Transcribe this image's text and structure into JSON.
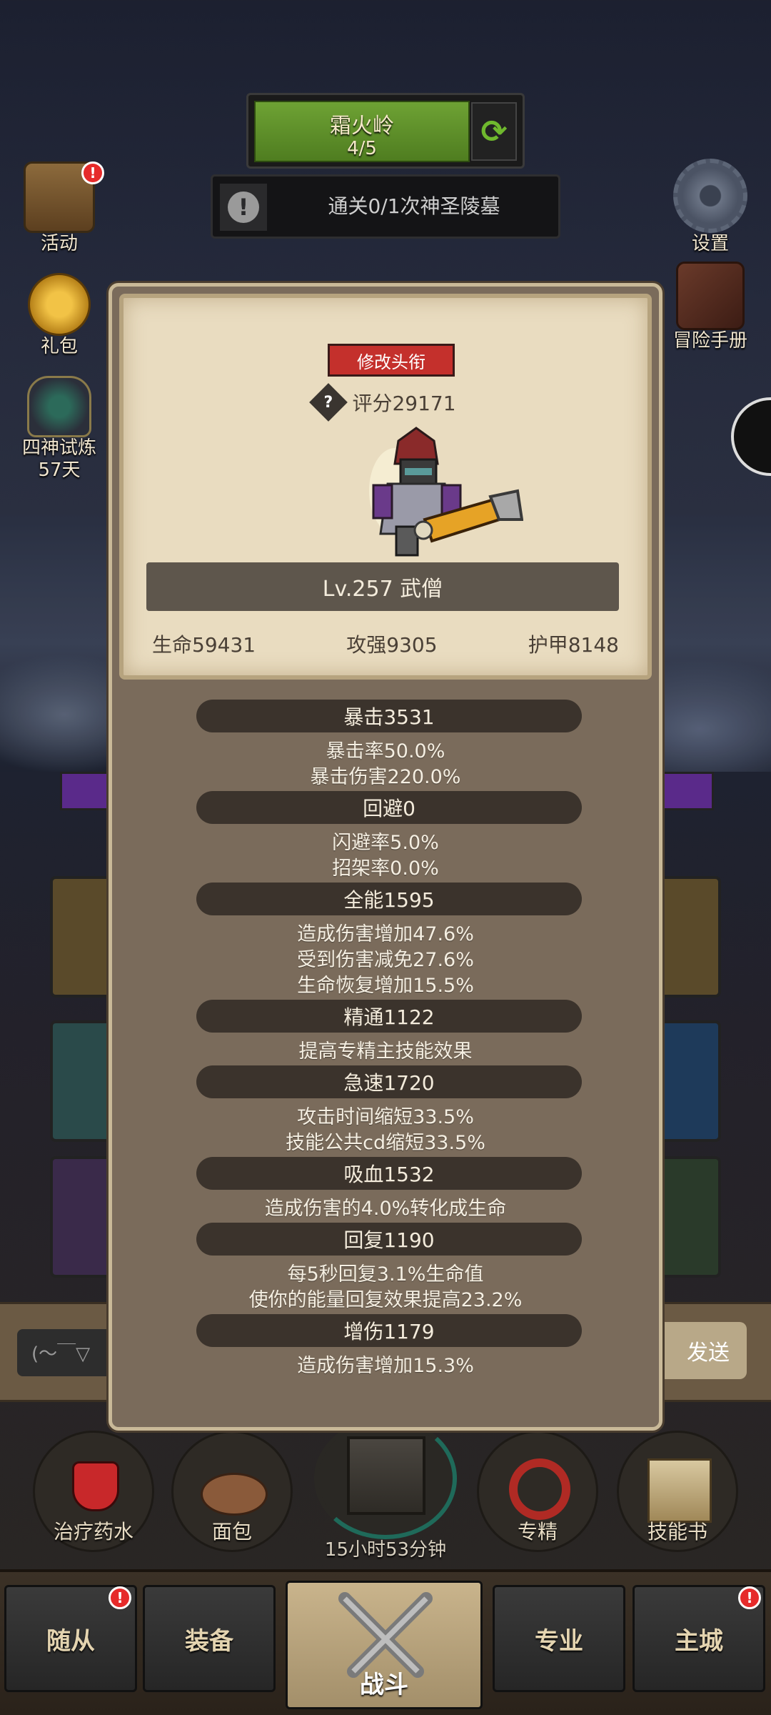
{
  "header": {
    "zone_name": "霜火岭",
    "zone_progress": "4/5",
    "quest_text": "通关0/1次神圣陵墓"
  },
  "left_icons": {
    "activity": "活动",
    "gift": "礼包",
    "trial": "四神试炼",
    "trial_days": "57天"
  },
  "right_icons": {
    "settings": "设置",
    "manual": "冒险手册"
  },
  "character_card": {
    "edit_title_button": "修改头衔",
    "score": "评分29171",
    "level_class": "Lv.257 武僧",
    "hp": "生命59431",
    "attack": "攻强9305",
    "armor": "护甲8148"
  },
  "stats": {
    "crit": {
      "header": "暴击3531",
      "lines": [
        "暴击率50.0%",
        "暴击伤害220.0%"
      ]
    },
    "dodge": {
      "header": "回避0",
      "lines": [
        "闪避率5.0%",
        "招架率0.0%"
      ]
    },
    "versatility": {
      "header": "全能1595",
      "lines": [
        "造成伤害增加47.6%",
        "受到伤害减免27.6%",
        "生命恢复增加15.5%"
      ]
    },
    "mastery": {
      "header": "精通1122",
      "lines": [
        "提高专精主技能效果"
      ]
    },
    "haste": {
      "header": "急速1720",
      "lines": [
        "攻击时间缩短33.5%",
        "技能公共cd缩短33.5%"
      ]
    },
    "lifesteal": {
      "header": "吸血1532",
      "lines": [
        "造成伤害的4.0%转化成生命"
      ]
    },
    "regen": {
      "header": "回复1190",
      "lines": [
        "每5秒回复3.1%生命值",
        "使你的能量回复效果提高23.2%"
      ]
    },
    "damage_bonus": {
      "header": "增伤1179",
      "lines": [
        "造成伤害增加15.3%"
      ]
    }
  },
  "chat": {
    "input_text": "(～￣▽",
    "send_label": "发送"
  },
  "tools": {
    "potion": "治疗药水",
    "bread": "面包",
    "chest_timer": "15小时53分钟",
    "specialization": "专精",
    "skill_book": "技能书"
  },
  "nav": {
    "followers": "随从",
    "equipment": "装备",
    "battle": "战斗",
    "profession": "专业",
    "main_city": "主城"
  },
  "colors": {
    "panel_bg": "#7a6b5b",
    "card_bg": "#e9dcc0",
    "title_button": "#c4302c",
    "stat_header_bg": "#3b332c"
  }
}
